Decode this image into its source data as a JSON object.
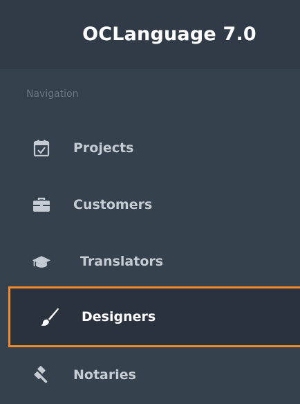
{
  "app": {
    "title": "OCLanguage 7.0"
  },
  "navigation": {
    "section_label": "Navigation",
    "items": [
      {
        "label": "Projects",
        "icon": "calendar-check-icon",
        "active": false
      },
      {
        "label": "Customers",
        "icon": "briefcase-icon",
        "active": false
      },
      {
        "label": "Translators",
        "icon": "graduation-cap-icon",
        "active": false
      },
      {
        "label": "Designers",
        "icon": "paintbrush-icon",
        "active": true
      },
      {
        "label": "Notaries",
        "icon": "gavel-icon",
        "active": false
      }
    ]
  },
  "colors": {
    "sidebar_bg": "#36414e",
    "brand_bg": "#303b47",
    "active_bg": "#2a333d",
    "highlight_border": "#f38b2e",
    "item_text": "#c6ccd3",
    "active_text": "#ffffff",
    "section_text": "#6b7683"
  }
}
